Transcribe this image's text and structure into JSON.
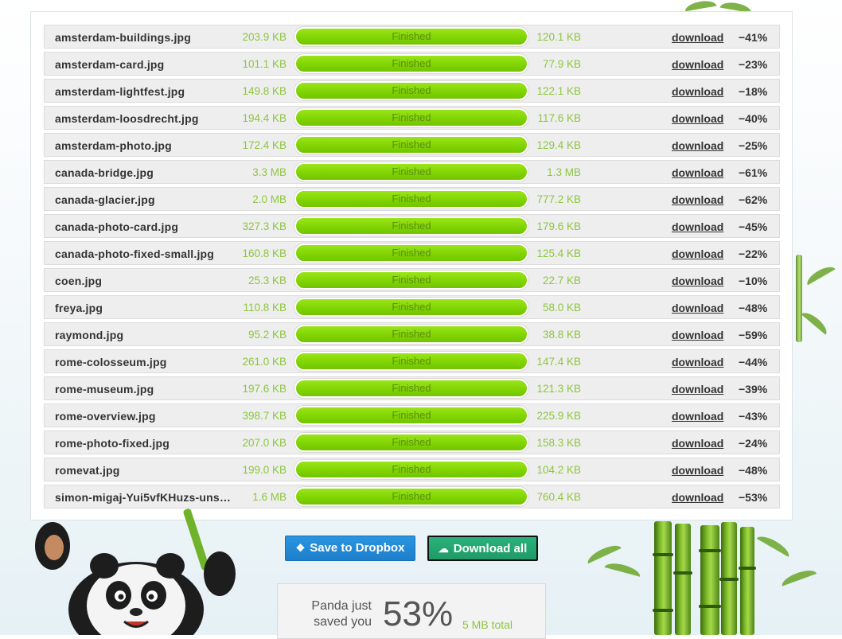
{
  "files": [
    {
      "name": "amsterdam-buildings.jpg",
      "original": "203.9 KB",
      "status": "Finished",
      "compressed": "120.1 KB",
      "download": "download",
      "saving": "−41%"
    },
    {
      "name": "amsterdam-card.jpg",
      "original": "101.1 KB",
      "status": "Finished",
      "compressed": "77.9 KB",
      "download": "download",
      "saving": "−23%"
    },
    {
      "name": "amsterdam-lightfest.jpg",
      "original": "149.8 KB",
      "status": "Finished",
      "compressed": "122.1 KB",
      "download": "download",
      "saving": "−18%"
    },
    {
      "name": "amsterdam-loosdrecht.jpg",
      "original": "194.4 KB",
      "status": "Finished",
      "compressed": "117.6 KB",
      "download": "download",
      "saving": "−40%"
    },
    {
      "name": "amsterdam-photo.jpg",
      "original": "172.4 KB",
      "status": "Finished",
      "compressed": "129.4 KB",
      "download": "download",
      "saving": "−25%"
    },
    {
      "name": "canada-bridge.jpg",
      "original": "3.3 MB",
      "status": "Finished",
      "compressed": "1.3 MB",
      "download": "download",
      "saving": "−61%"
    },
    {
      "name": "canada-glacier.jpg",
      "original": "2.0 MB",
      "status": "Finished",
      "compressed": "777.2 KB",
      "download": "download",
      "saving": "−62%"
    },
    {
      "name": "canada-photo-card.jpg",
      "original": "327.3 KB",
      "status": "Finished",
      "compressed": "179.6 KB",
      "download": "download",
      "saving": "−45%"
    },
    {
      "name": "canada-photo-fixed-small.jpg",
      "original": "160.8 KB",
      "status": "Finished",
      "compressed": "125.4 KB",
      "download": "download",
      "saving": "−22%"
    },
    {
      "name": "coen.jpg",
      "original": "25.3 KB",
      "status": "Finished",
      "compressed": "22.7 KB",
      "download": "download",
      "saving": "−10%"
    },
    {
      "name": "freya.jpg",
      "original": "110.8 KB",
      "status": "Finished",
      "compressed": "58.0 KB",
      "download": "download",
      "saving": "−48%"
    },
    {
      "name": "raymond.jpg",
      "original": "95.2 KB",
      "status": "Finished",
      "compressed": "38.8 KB",
      "download": "download",
      "saving": "−59%"
    },
    {
      "name": "rome-colosseum.jpg",
      "original": "261.0 KB",
      "status": "Finished",
      "compressed": "147.4 KB",
      "download": "download",
      "saving": "−44%"
    },
    {
      "name": "rome-museum.jpg",
      "original": "197.6 KB",
      "status": "Finished",
      "compressed": "121.3 KB",
      "download": "download",
      "saving": "−39%"
    },
    {
      "name": "rome-overview.jpg",
      "original": "398.7 KB",
      "status": "Finished",
      "compressed": "225.9 KB",
      "download": "download",
      "saving": "−43%"
    },
    {
      "name": "rome-photo-fixed.jpg",
      "original": "207.0 KB",
      "status": "Finished",
      "compressed": "158.3 KB",
      "download": "download",
      "saving": "−24%"
    },
    {
      "name": "romevat.jpg",
      "original": "199.0 KB",
      "status": "Finished",
      "compressed": "104.2 KB",
      "download": "download",
      "saving": "−48%"
    },
    {
      "name": "simon-migaj-Yui5vfKHuzs-unsp…",
      "original": "1.6 MB",
      "status": "Finished",
      "compressed": "760.4 KB",
      "download": "download",
      "saving": "−53%"
    }
  ],
  "buttons": {
    "dropbox": "Save to Dropbox",
    "dropbox_icon": "dropbox-icon",
    "download_all": "Download all",
    "download_all_icon": "cloud-download-icon"
  },
  "summary": {
    "label": "Panda just saved you",
    "percent": "53%",
    "total": "5 MB total"
  },
  "colors": {
    "progress": "#7fd300",
    "size_text": "#8cc63f",
    "dropbox_button": "#1d7fcc",
    "download_all_button": "#1f9a67"
  }
}
